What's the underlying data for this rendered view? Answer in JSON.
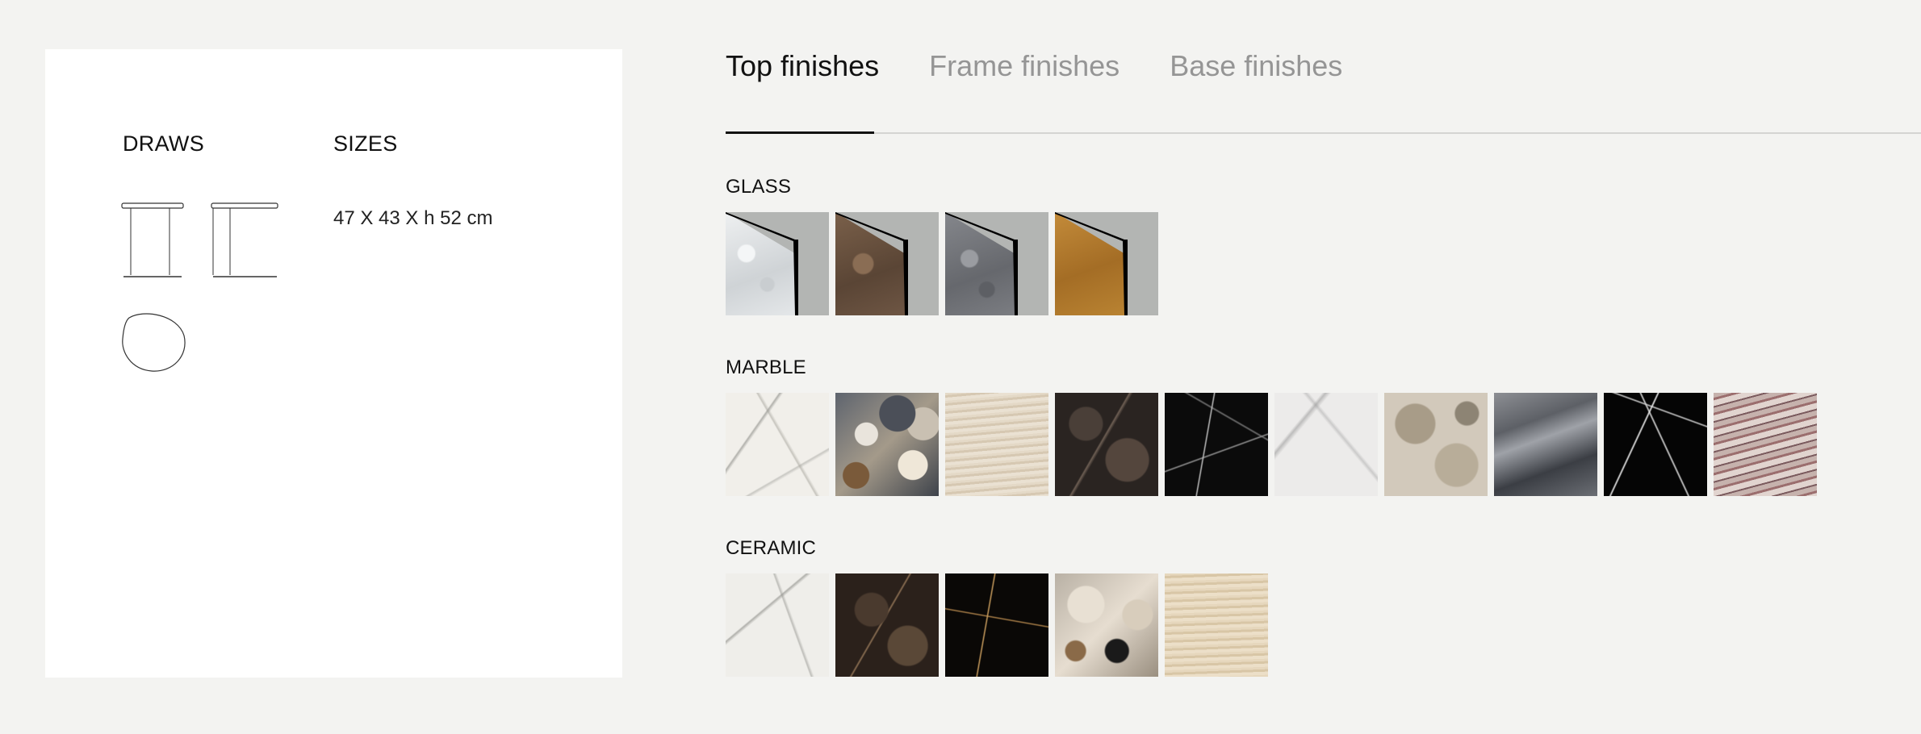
{
  "product_card": {
    "draws_title": "DRAWS",
    "sizes_title": "SIZES",
    "sizes_value": "47 X 43 X h 52 cm"
  },
  "tabs": [
    {
      "label": "Top finishes",
      "active": true
    },
    {
      "label": "Frame finishes",
      "active": false
    },
    {
      "label": "Base finishes",
      "active": false
    }
  ],
  "groups": {
    "glass": {
      "label": "GLASS",
      "swatches": [
        {
          "color": "#dfe2e4"
        },
        {
          "color": "#6b5441"
        },
        {
          "color": "#76787d"
        },
        {
          "color": "#b0782e"
        }
      ]
    },
    "marble": {
      "label": "MARBLE",
      "swatch_count": 10
    },
    "ceramic": {
      "label": "CERAMIC",
      "swatch_count": 5
    }
  },
  "colors": {
    "page_background": "#f3f3f1",
    "card_background": "#ffffff",
    "active_tab": "#111111",
    "inactive_tab": "#959595",
    "glass_swatch_background": "#b3b5b3"
  }
}
